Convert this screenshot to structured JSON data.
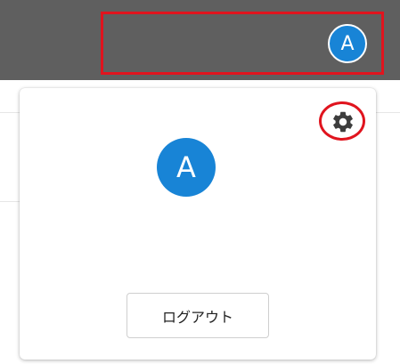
{
  "header": {
    "avatar_initial": "A",
    "avatar_color": "#1884d6",
    "background_color": "#5f5f5f"
  },
  "highlights": {
    "color": "#e0141e"
  },
  "profile_card": {
    "avatar_initial": "A",
    "settings_icon": "gear-icon",
    "logout_label": "ログアウト"
  }
}
